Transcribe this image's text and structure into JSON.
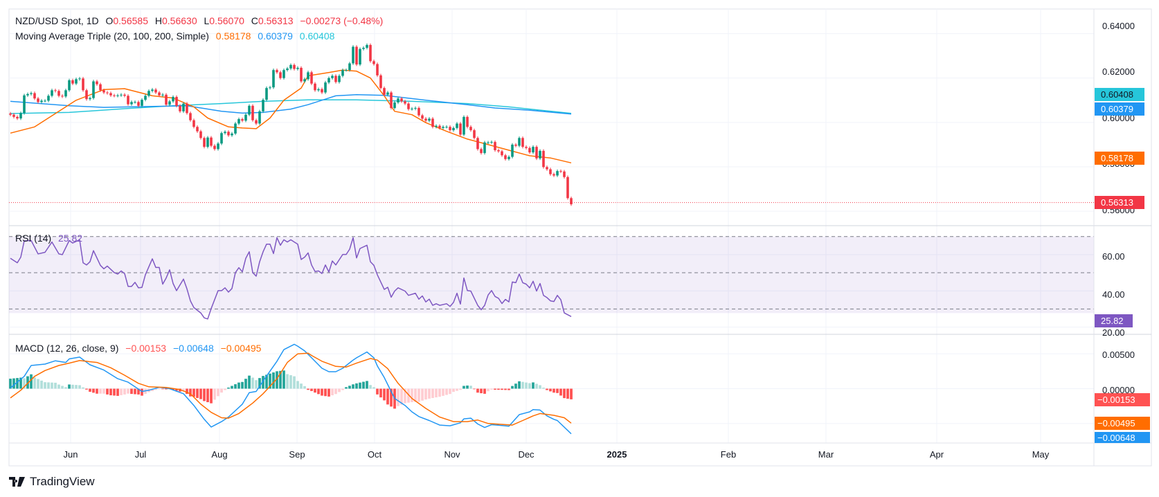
{
  "header": {
    "symbol": "NZD/USD Spot, 1D",
    "open_label": "O",
    "open": "0.56585",
    "high_label": "H",
    "high": "0.56630",
    "low_label": "L",
    "low": "0.56070",
    "close_label": "C",
    "close": "0.56313",
    "change": "−0.00273 (−0.48%)"
  },
  "ma_legend": {
    "title": "Moving Average Triple (20, 100, 200, Simple)",
    "ma20": "0.58178",
    "ma100": "0.60379",
    "ma200": "0.60408"
  },
  "rsi_legend": {
    "title": "RSI (14)",
    "value": "25.82"
  },
  "macd_legend": {
    "title": "MACD (12, 26, close, 9)",
    "hist": "−0.00153",
    "macd": "−0.00648",
    "signal": "−0.00495"
  },
  "price_axis": [
    "0.64000",
    "0.62000",
    "0.60000",
    "0.58000",
    "0.56000"
  ],
  "rsi_axis": [
    "60.00",
    "40.00",
    "20.00"
  ],
  "macd_axis": [
    "0.00500",
    "0.00000"
  ],
  "price_boxes": {
    "ma200": "0.60408",
    "ma100": "0.60379",
    "ma20": "0.58178",
    "last": "0.56313"
  },
  "rsi_box": "25.82",
  "macd_boxes": {
    "hist": "−0.00153",
    "signal": "−0.00495",
    "macd": "−0.00648"
  },
  "time_axis": [
    "Jun",
    "Jul",
    "Aug",
    "Sep",
    "Oct",
    "Nov",
    "Dec",
    "2025",
    "Feb",
    "Mar",
    "Apr",
    "May"
  ],
  "brand": "TradingView",
  "colors": {
    "up": "#089981",
    "down": "#f23645",
    "ma20": "#ff6d00",
    "ma100": "#2196f3",
    "ma200": "#26c6da",
    "rsi": "#7e57c2",
    "macd": "#2196f3",
    "signal": "#ff6d00",
    "hist_up_strong": "#26a69a",
    "hist_up_weak": "#b2dfdb",
    "hist_down_strong": "#ff5252",
    "hist_down_weak": "#ffcdd2"
  },
  "chart_data": {
    "type": "candlestick",
    "price_ylim": [
      0.5535,
      0.6511
    ],
    "closes": [
      0.6035,
      0.6025,
      0.6018,
      0.6042,
      0.6122,
      0.6128,
      0.6132,
      0.6108,
      0.6092,
      0.6098,
      0.6098,
      0.612,
      0.6145,
      0.6142,
      0.612,
      0.6117,
      0.6145,
      0.619,
      0.6175,
      0.6195,
      0.6198,
      0.6145,
      0.6105,
      0.611,
      0.6185,
      0.6172,
      0.6145,
      0.6135,
      0.6132,
      0.6122,
      0.612,
      0.6122,
      0.6125,
      0.612,
      0.6082,
      0.6092,
      0.6092,
      0.6075,
      0.6102,
      0.612,
      0.6142,
      0.6148,
      0.6135,
      0.6122,
      0.6125,
      0.608,
      0.6095,
      0.6115,
      0.6075,
      0.605,
      0.6085,
      0.6042,
      0.601,
      0.598,
      0.596,
      0.593,
      0.589,
      0.5932,
      0.5895,
      0.588,
      0.5905,
      0.5952,
      0.5958,
      0.5942,
      0.595,
      0.5995,
      0.6015,
      0.6008,
      0.6035,
      0.6075,
      0.601,
      0.5995,
      0.605,
      0.6102,
      0.6155,
      0.6158,
      0.6236,
      0.6226,
      0.62,
      0.6236,
      0.6243,
      0.6259,
      0.6241,
      0.6246,
      0.6185,
      0.6195,
      0.6226,
      0.6175,
      0.6145,
      0.615,
      0.6135,
      0.618,
      0.62,
      0.621,
      0.6182,
      0.621,
      0.6236,
      0.6236,
      0.6266,
      0.6341,
      0.6261,
      0.6331,
      0.6336,
      0.6349,
      0.6276,
      0.6263,
      0.6212,
      0.6155,
      0.6125,
      0.6135,
      0.6065,
      0.609,
      0.6108,
      0.6095,
      0.6085,
      0.606,
      0.6062,
      0.6065,
      0.6032,
      0.6017,
      0.6008,
      0.6017,
      0.598,
      0.5985,
      0.5975,
      0.598,
      0.598,
      0.5965,
      0.5975,
      0.5995,
      0.5945,
      0.6025,
      0.598,
      0.5965,
      0.593,
      0.588,
      0.5862,
      0.591,
      0.591,
      0.5912,
      0.5875,
      0.587,
      0.5852,
      0.5835,
      0.5845,
      0.59,
      0.5895,
      0.593,
      0.589,
      0.5885,
      0.5865,
      0.589,
      0.5838,
      0.5872,
      0.5799,
      0.5789,
      0.5767,
      0.5761,
      0.5781,
      0.5779,
      0.5754,
      0.5659,
      0.56313
    ],
    "ma20": [
      [
        0,
        0.5952
      ],
      [
        7,
        0.598
      ],
      [
        13,
        0.604
      ],
      [
        19,
        0.61
      ],
      [
        27,
        0.6148
      ],
      [
        33,
        0.6152
      ],
      [
        41,
        0.612
      ],
      [
        47,
        0.611
      ],
      [
        53,
        0.607
      ],
      [
        57,
        0.602
      ],
      [
        63,
        0.598
      ],
      [
        67,
        0.5975
      ],
      [
        71,
        0.5972
      ],
      [
        75,
        0.602
      ],
      [
        79,
        0.61
      ],
      [
        84,
        0.6155
      ],
      [
        86,
        0.621
      ],
      [
        92,
        0.6225
      ],
      [
        96,
        0.6236
      ],
      [
        100,
        0.6231
      ],
      [
        104,
        0.62
      ],
      [
        108,
        0.612
      ],
      [
        111,
        0.605
      ],
      [
        116,
        0.6035
      ],
      [
        120,
        0.5999
      ],
      [
        126,
        0.596
      ],
      [
        132,
        0.5925
      ],
      [
        138,
        0.59
      ],
      [
        144,
        0.5875
      ],
      [
        150,
        0.585
      ],
      [
        156,
        0.584
      ],
      [
        162,
        0.58178
      ]
    ],
    "ma100": [
      [
        0,
        0.6095
      ],
      [
        17,
        0.6075
      ],
      [
        27,
        0.6068
      ],
      [
        41,
        0.6072
      ],
      [
        51,
        0.6075
      ],
      [
        61,
        0.605
      ],
      [
        67,
        0.6042
      ],
      [
        73,
        0.6045
      ],
      [
        81,
        0.606
      ],
      [
        86,
        0.608
      ],
      [
        90,
        0.61
      ],
      [
        94,
        0.612
      ],
      [
        100,
        0.6125
      ],
      [
        108,
        0.6122
      ],
      [
        120,
        0.61
      ],
      [
        132,
        0.608
      ],
      [
        140,
        0.6065
      ],
      [
        150,
        0.6055
      ],
      [
        162,
        0.60379
      ]
    ],
    "ma200": [
      [
        0,
        0.604
      ],
      [
        17,
        0.6045
      ],
      [
        33,
        0.6062
      ],
      [
        47,
        0.6075
      ],
      [
        61,
        0.6085
      ],
      [
        73,
        0.6095
      ],
      [
        86,
        0.6102
      ],
      [
        100,
        0.6102
      ],
      [
        116,
        0.6095
      ],
      [
        132,
        0.6085
      ],
      [
        144,
        0.607
      ],
      [
        162,
        0.60408
      ]
    ],
    "rsi": [
      [
        0,
        58.0
      ],
      [
        2,
        55.5
      ],
      [
        3,
        58.6
      ],
      [
        4,
        67.6
      ],
      [
        6,
        67.8
      ],
      [
        8,
        60.4
      ],
      [
        10,
        61.3
      ],
      [
        12,
        67.0
      ],
      [
        14,
        60.4
      ],
      [
        15,
        60.0
      ],
      [
        17,
        67.8
      ],
      [
        18,
        66.4
      ],
      [
        20,
        68.2
      ],
      [
        21,
        55.5
      ],
      [
        22,
        54.3
      ],
      [
        23,
        56.1
      ],
      [
        24,
        62.2
      ],
      [
        26,
        54.1
      ],
      [
        27,
        52.2
      ],
      [
        28,
        53.7
      ],
      [
        30,
        50.1
      ],
      [
        31,
        49.3
      ],
      [
        32,
        51.0
      ],
      [
        33,
        49.5
      ],
      [
        34,
        42.5
      ],
      [
        35,
        42.5
      ],
      [
        36,
        44.7
      ],
      [
        37,
        41.7
      ],
      [
        38,
        41.9
      ],
      [
        39,
        48.9
      ],
      [
        41,
        57.7
      ],
      [
        42,
        52.9
      ],
      [
        43,
        52.9
      ],
      [
        44,
        43.7
      ],
      [
        45,
        47.1
      ],
      [
        46,
        51.6
      ],
      [
        47,
        44.1
      ],
      [
        48,
        40.1
      ],
      [
        50,
        46.5
      ],
      [
        51,
        41.1
      ],
      [
        52,
        34.5
      ],
      [
        53,
        30.8
      ],
      [
        55,
        27.8
      ],
      [
        56,
        25.1
      ],
      [
        57,
        24.5
      ],
      [
        58,
        30.2
      ],
      [
        60,
        40.1
      ],
      [
        61,
        40.1
      ],
      [
        62,
        41.7
      ],
      [
        63,
        39.3
      ],
      [
        64,
        41.3
      ],
      [
        65,
        50.1
      ],
      [
        66,
        52.8
      ],
      [
        67,
        50.5
      ],
      [
        68,
        58.0
      ],
      [
        69,
        61.6
      ],
      [
        70,
        50.1
      ],
      [
        71,
        48.1
      ],
      [
        72,
        56.1
      ],
      [
        73,
        61.6
      ],
      [
        74,
        65.8
      ],
      [
        75,
        65.8
      ],
      [
        76,
        60.6
      ],
      [
        77,
        69.4
      ],
      [
        78,
        65.2
      ],
      [
        79,
        68.2
      ],
      [
        80,
        67.0
      ],
      [
        81,
        68.2
      ],
      [
        82,
        67.0
      ],
      [
        83,
        65.8
      ],
      [
        84,
        57.3
      ],
      [
        85,
        58.6
      ],
      [
        86,
        61.0
      ],
      [
        87,
        54.3
      ],
      [
        88,
        50.7
      ],
      [
        89,
        51.0
      ],
      [
        90,
        49.6
      ],
      [
        91,
        54.3
      ],
      [
        92,
        50.4
      ],
      [
        93,
        56.5
      ],
      [
        94,
        54.3
      ],
      [
        96,
        60.1
      ],
      [
        97,
        60.1
      ],
      [
        98,
        63.0
      ],
      [
        99,
        69.4
      ],
      [
        100,
        58.2
      ],
      [
        101,
        63.4
      ],
      [
        103,
        65.2
      ],
      [
        104,
        56.1
      ],
      [
        105,
        54.1
      ],
      [
        106,
        48.9
      ],
      [
        108,
        40.8
      ],
      [
        109,
        42.0
      ],
      [
        110,
        36.5
      ],
      [
        111,
        39.9
      ],
      [
        112,
        41.7
      ],
      [
        114,
        39.9
      ],
      [
        115,
        37.5
      ],
      [
        117,
        38.7
      ],
      [
        118,
        35.4
      ],
      [
        119,
        37.2
      ],
      [
        120,
        33.9
      ],
      [
        121,
        35.4
      ],
      [
        122,
        32.0
      ],
      [
        123,
        32.9
      ],
      [
        124,
        32.0
      ],
      [
        126,
        32.9
      ],
      [
        127,
        31.4
      ],
      [
        128,
        33.6
      ],
      [
        129,
        38.7
      ],
      [
        130,
        32.7
      ],
      [
        131,
        47.1
      ],
      [
        132,
        40.2
      ],
      [
        133,
        39.9
      ],
      [
        135,
        32.0
      ],
      [
        136,
        29.6
      ],
      [
        137,
        32.0
      ],
      [
        138,
        37.7
      ],
      [
        139,
        40.2
      ],
      [
        140,
        36.9
      ],
      [
        141,
        35.9
      ],
      [
        142,
        33.0
      ],
      [
        143,
        35.3
      ],
      [
        144,
        33.9
      ],
      [
        145,
        44.9
      ],
      [
        146,
        44.5
      ],
      [
        147,
        49.3
      ],
      [
        148,
        44.5
      ],
      [
        149,
        43.7
      ],
      [
        150,
        41.7
      ],
      [
        151,
        45.3
      ],
      [
        152,
        39.9
      ],
      [
        153,
        44.1
      ],
      [
        154,
        37.5
      ],
      [
        155,
        36.3
      ],
      [
        156,
        34.5
      ],
      [
        157,
        34.1
      ],
      [
        158,
        37.5
      ],
      [
        159,
        35.1
      ],
      [
        160,
        27.8
      ],
      [
        162,
        25.82
      ]
    ],
    "rsi_levels": [
      70,
      50,
      30
    ],
    "rsi_ylim": [
      16,
      76
    ],
    "macd": [
      [
        0,
        0.0001
      ],
      [
        4,
        0.00177
      ],
      [
        6,
        0.00333
      ],
      [
        10,
        0.00353
      ],
      [
        13,
        0.004
      ],
      [
        16,
        0.00377
      ],
      [
        17,
        0.00427
      ],
      [
        20,
        0.00453
      ],
      [
        23,
        0.00343
      ],
      [
        27,
        0.00267
      ],
      [
        31,
        0.00143
      ],
      [
        34,
        0.00093
      ],
      [
        38,
        -0.0004
      ],
      [
        40,
        -0.00023
      ],
      [
        43,
        0.0002
      ],
      [
        46,
        0.0
      ],
      [
        50,
        -0.00073
      ],
      [
        53,
        -0.0024
      ],
      [
        56,
        -0.0044
      ],
      [
        58,
        -0.0055
      ],
      [
        61,
        -0.00473
      ],
      [
        63,
        -0.00407
      ],
      [
        67,
        -0.00223
      ],
      [
        69,
        -0.00057
      ],
      [
        71,
        -0.0004
      ],
      [
        73,
        0.0011
      ],
      [
        77,
        0.00393
      ],
      [
        79,
        0.0056
      ],
      [
        82,
        0.00637
      ],
      [
        83,
        0.0061
      ],
      [
        85,
        0.00543
      ],
      [
        87,
        0.00443
      ],
      [
        90,
        0.00293
      ],
      [
        92,
        0.00243
      ],
      [
        94,
        0.00243
      ],
      [
        96,
        0.00293
      ],
      [
        99,
        0.0041
      ],
      [
        100,
        0.00443
      ],
      [
        103,
        0.00527
      ],
      [
        105,
        0.00443
      ],
      [
        106,
        0.00327
      ],
      [
        108,
        0.0016
      ],
      [
        109,
        0.0006
      ],
      [
        111,
        -0.0014
      ],
      [
        114,
        -0.0024
      ],
      [
        116,
        -0.00333
      ],
      [
        118,
        -0.004
      ],
      [
        121,
        -0.00457
      ],
      [
        124,
        -0.00523
      ],
      [
        127,
        -0.00533
      ],
      [
        130,
        -0.0049
      ],
      [
        131,
        -0.00433
      ],
      [
        133,
        -0.00423
      ],
      [
        135,
        -0.00507
      ],
      [
        137,
        -0.00557
      ],
      [
        139,
        -0.00517
      ],
      [
        142,
        -0.0053
      ],
      [
        144,
        -0.0054
      ],
      [
        147,
        -0.00373
      ],
      [
        150,
        -0.00333
      ],
      [
        151,
        -0.003
      ],
      [
        153,
        -0.00307
      ],
      [
        155,
        -0.0039
      ],
      [
        157,
        -0.0044
      ],
      [
        158,
        -0.00457
      ],
      [
        162,
        -0.00648
      ]
    ],
    "signal": [
      [
        0,
        -0.00133
      ],
      [
        3,
        -0.00023
      ],
      [
        7,
        0.00177
      ],
      [
        10,
        0.0026
      ],
      [
        14,
        0.00333
      ],
      [
        17,
        0.00367
      ],
      [
        20,
        0.00403
      ],
      [
        25,
        0.00377
      ],
      [
        29,
        0.003
      ],
      [
        33,
        0.00193
      ],
      [
        37,
        0.00077
      ],
      [
        40,
        0.00027
      ],
      [
        45,
        0.00017
      ],
      [
        49,
        -0.00013
      ],
      [
        52,
        -0.00073
      ],
      [
        55,
        -0.00223
      ],
      [
        58,
        -0.0034
      ],
      [
        61,
        -0.00417
      ],
      [
        63,
        -0.00423
      ],
      [
        66,
        -0.00357
      ],
      [
        70,
        -0.00207
      ],
      [
        73,
        -0.00073
      ],
      [
        77,
        0.00143
      ],
      [
        80,
        0.00377
      ],
      [
        83,
        0.005
      ],
      [
        86,
        0.0051
      ],
      [
        87,
        0.00477
      ],
      [
        90,
        0.00393
      ],
      [
        94,
        0.0032
      ],
      [
        97,
        0.0031
      ],
      [
        100,
        0.00367
      ],
      [
        104,
        0.00433
      ],
      [
        106,
        0.0041
      ],
      [
        109,
        0.00287
      ],
      [
        112,
        0.00077
      ],
      [
        116,
        -0.0014
      ],
      [
        120,
        -0.00283
      ],
      [
        124,
        -0.00407
      ],
      [
        128,
        -0.00473
      ],
      [
        132,
        -0.00473
      ],
      [
        135,
        -0.0045
      ],
      [
        138,
        -0.005
      ],
      [
        142,
        -0.00513
      ],
      [
        145,
        -0.00523
      ],
      [
        148,
        -0.00457
      ],
      [
        151,
        -0.0039
      ],
      [
        153,
        -0.00357
      ],
      [
        157,
        -0.00383
      ],
      [
        160,
        -0.00417
      ],
      [
        162,
        -0.00495
      ]
    ],
    "macd_ylim": [
      -0.0078,
      0.0078
    ]
  }
}
